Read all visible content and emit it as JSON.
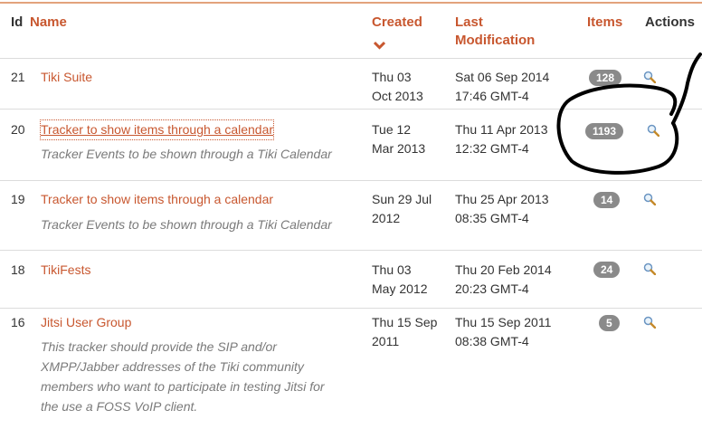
{
  "header": {
    "id": "Id",
    "name": "Name",
    "created": "Created",
    "last_mod_line1": "Last",
    "last_mod_line2": "Modification",
    "items": "Items",
    "actions": "Actions"
  },
  "rows": [
    {
      "id": "21",
      "name": "Tiki Suite",
      "description": [],
      "created": [
        "Thu 03",
        "Oct 2013"
      ],
      "modified": [
        "Sat 06 Sep 2014",
        "17:46 GMT-4"
      ],
      "items": "128"
    },
    {
      "id": "20",
      "name": "Tracker to show items through a calendar",
      "description": [
        "Tracker Events to be shown through a Tiki Calendar"
      ],
      "created": [
        "Tue 12",
        "Mar 2013"
      ],
      "modified": [
        "Thu 11 Apr 2013",
        "12:32 GMT-4"
      ],
      "items": "1193"
    },
    {
      "id": "19",
      "name": "Tracker to show items through a calendar",
      "description": [
        "Tracker Events to be shown through a Tiki Calendar"
      ],
      "created": [
        "Sun 29 Jul",
        "2012"
      ],
      "modified": [
        "Thu 25 Apr 2013",
        "08:35 GMT-4"
      ],
      "items": "14"
    },
    {
      "id": "18",
      "name": "TikiFests",
      "description": [],
      "created": [
        "Thu 03",
        "May 2012"
      ],
      "modified": [
        "Thu 20 Feb 2014",
        "20:23 GMT-4"
      ],
      "items": "24"
    },
    {
      "id": "16",
      "name": "Jitsi User Group",
      "description": [
        "This tracker should provide the SIP and/or",
        "XMPP/Jabber addresses of the Tiki community",
        "members who want to participate in testing Jitsi for",
        "the use a FOSS VoIP client."
      ],
      "created": [
        "Thu 15 Sep",
        "2011"
      ],
      "modified": [
        "Thu 15 Sep 2011",
        "08:38 GMT-4"
      ],
      "items": "5"
    }
  ],
  "colors": {
    "link": "#c8572f",
    "badge": "#8a8a8a",
    "header_line": "#e3a37c",
    "annotation": "#000000"
  },
  "icons": {
    "sort": "chevron-down-icon",
    "view": "magnifier-icon"
  }
}
